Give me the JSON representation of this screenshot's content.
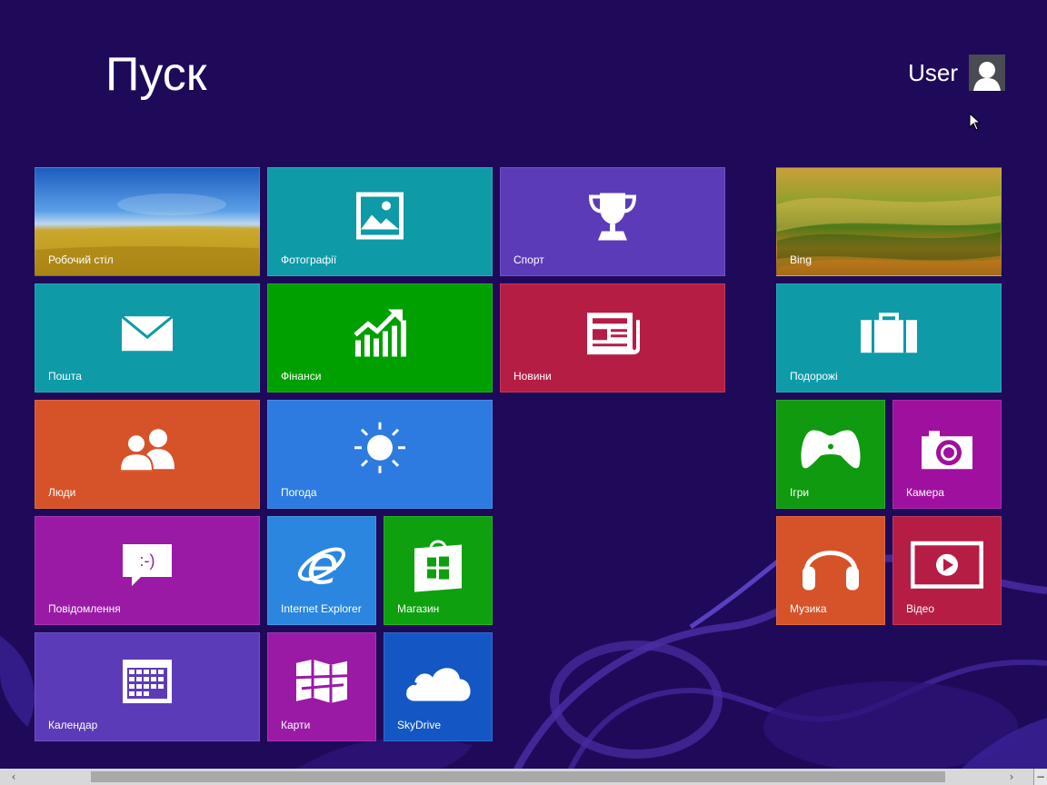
{
  "screen": {
    "title": "Пуск"
  },
  "user": {
    "name": "User",
    "avatar_icon": "user-silhouette-icon"
  },
  "tiles": {
    "desktop": {
      "label": "Робочий стіл",
      "color": "#2a6fb0"
    },
    "photos": {
      "label": "Фотографії",
      "color": "#0e9aa7",
      "icon": "photo-icon"
    },
    "sport": {
      "label": "Спорт",
      "color": "#5c3bb8",
      "icon": "trophy-icon"
    },
    "bing": {
      "label": "Bing",
      "color": "#6a8a2a"
    },
    "mail": {
      "label": "Пошта",
      "color": "#0e9aa7",
      "icon": "mail-icon"
    },
    "finance": {
      "label": "Фінанси",
      "color": "#00a000",
      "icon": "finance-chart-icon"
    },
    "news": {
      "label": "Новини",
      "color": "#b51d45",
      "icon": "newspaper-icon"
    },
    "travel": {
      "label": "Подорожі",
      "color": "#0e9aa7",
      "icon": "suitcase-icon"
    },
    "people": {
      "label": "Люди",
      "color": "#d6532a",
      "icon": "people-icon"
    },
    "weather": {
      "label": "Погода",
      "color": "#2d7be0",
      "icon": "sun-icon"
    },
    "games": {
      "label": "Ігри",
      "color": "#0f9a0f",
      "icon": "gamepad-icon"
    },
    "camera": {
      "label": "Камера",
      "color": "#a0109e",
      "icon": "camera-icon"
    },
    "messaging": {
      "label": "Повідомлення",
      "color": "#9a1aa6",
      "icon": "chat-bubble-icon"
    },
    "ie": {
      "label": "Internet Explorer",
      "color": "#2b86e0",
      "icon": "internet-explorer-icon"
    },
    "store": {
      "label": "Магазин",
      "color": "#0ea00e",
      "icon": "store-bag-icon"
    },
    "music": {
      "label": "Музика",
      "color": "#d6532a",
      "icon": "headphones-icon"
    },
    "video": {
      "label": "Відео",
      "color": "#b51d45",
      "icon": "video-play-icon"
    },
    "calendar": {
      "label": "Календар",
      "color": "#5c3bb8",
      "icon": "calendar-icon"
    },
    "maps": {
      "label": "Карти",
      "color": "#9a1aa6",
      "icon": "map-icon"
    },
    "skydrive": {
      "label": "SkyDrive",
      "color": "#1457c4",
      "icon": "cloud-icon"
    }
  },
  "scrollbar": {
    "left_arrow": "‹",
    "right_arrow": "›",
    "zoom_label": "−"
  },
  "colors": {
    "background": "#1f0a5a",
    "accent_swirl": "#5b3fb8"
  }
}
